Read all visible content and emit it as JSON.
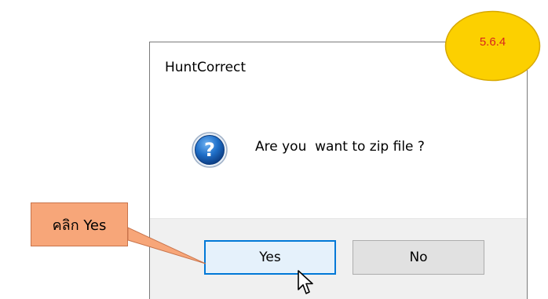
{
  "dialog": {
    "title": "HuntCorrect",
    "message": "Are you  want to zip file ?",
    "icon": "question-icon",
    "buttons": {
      "yes_label": "Yes",
      "no_label": "No"
    }
  },
  "annotation": {
    "callout_label": "คลิก Yes",
    "step_badge": "5.6.4"
  },
  "colors": {
    "callout_fill": "#f7a679",
    "badge_fill": "#fcd000",
    "badge_text": "#d8261e",
    "button_bar": "#f0f0f0",
    "yes_focus_border": "#0078d7"
  }
}
